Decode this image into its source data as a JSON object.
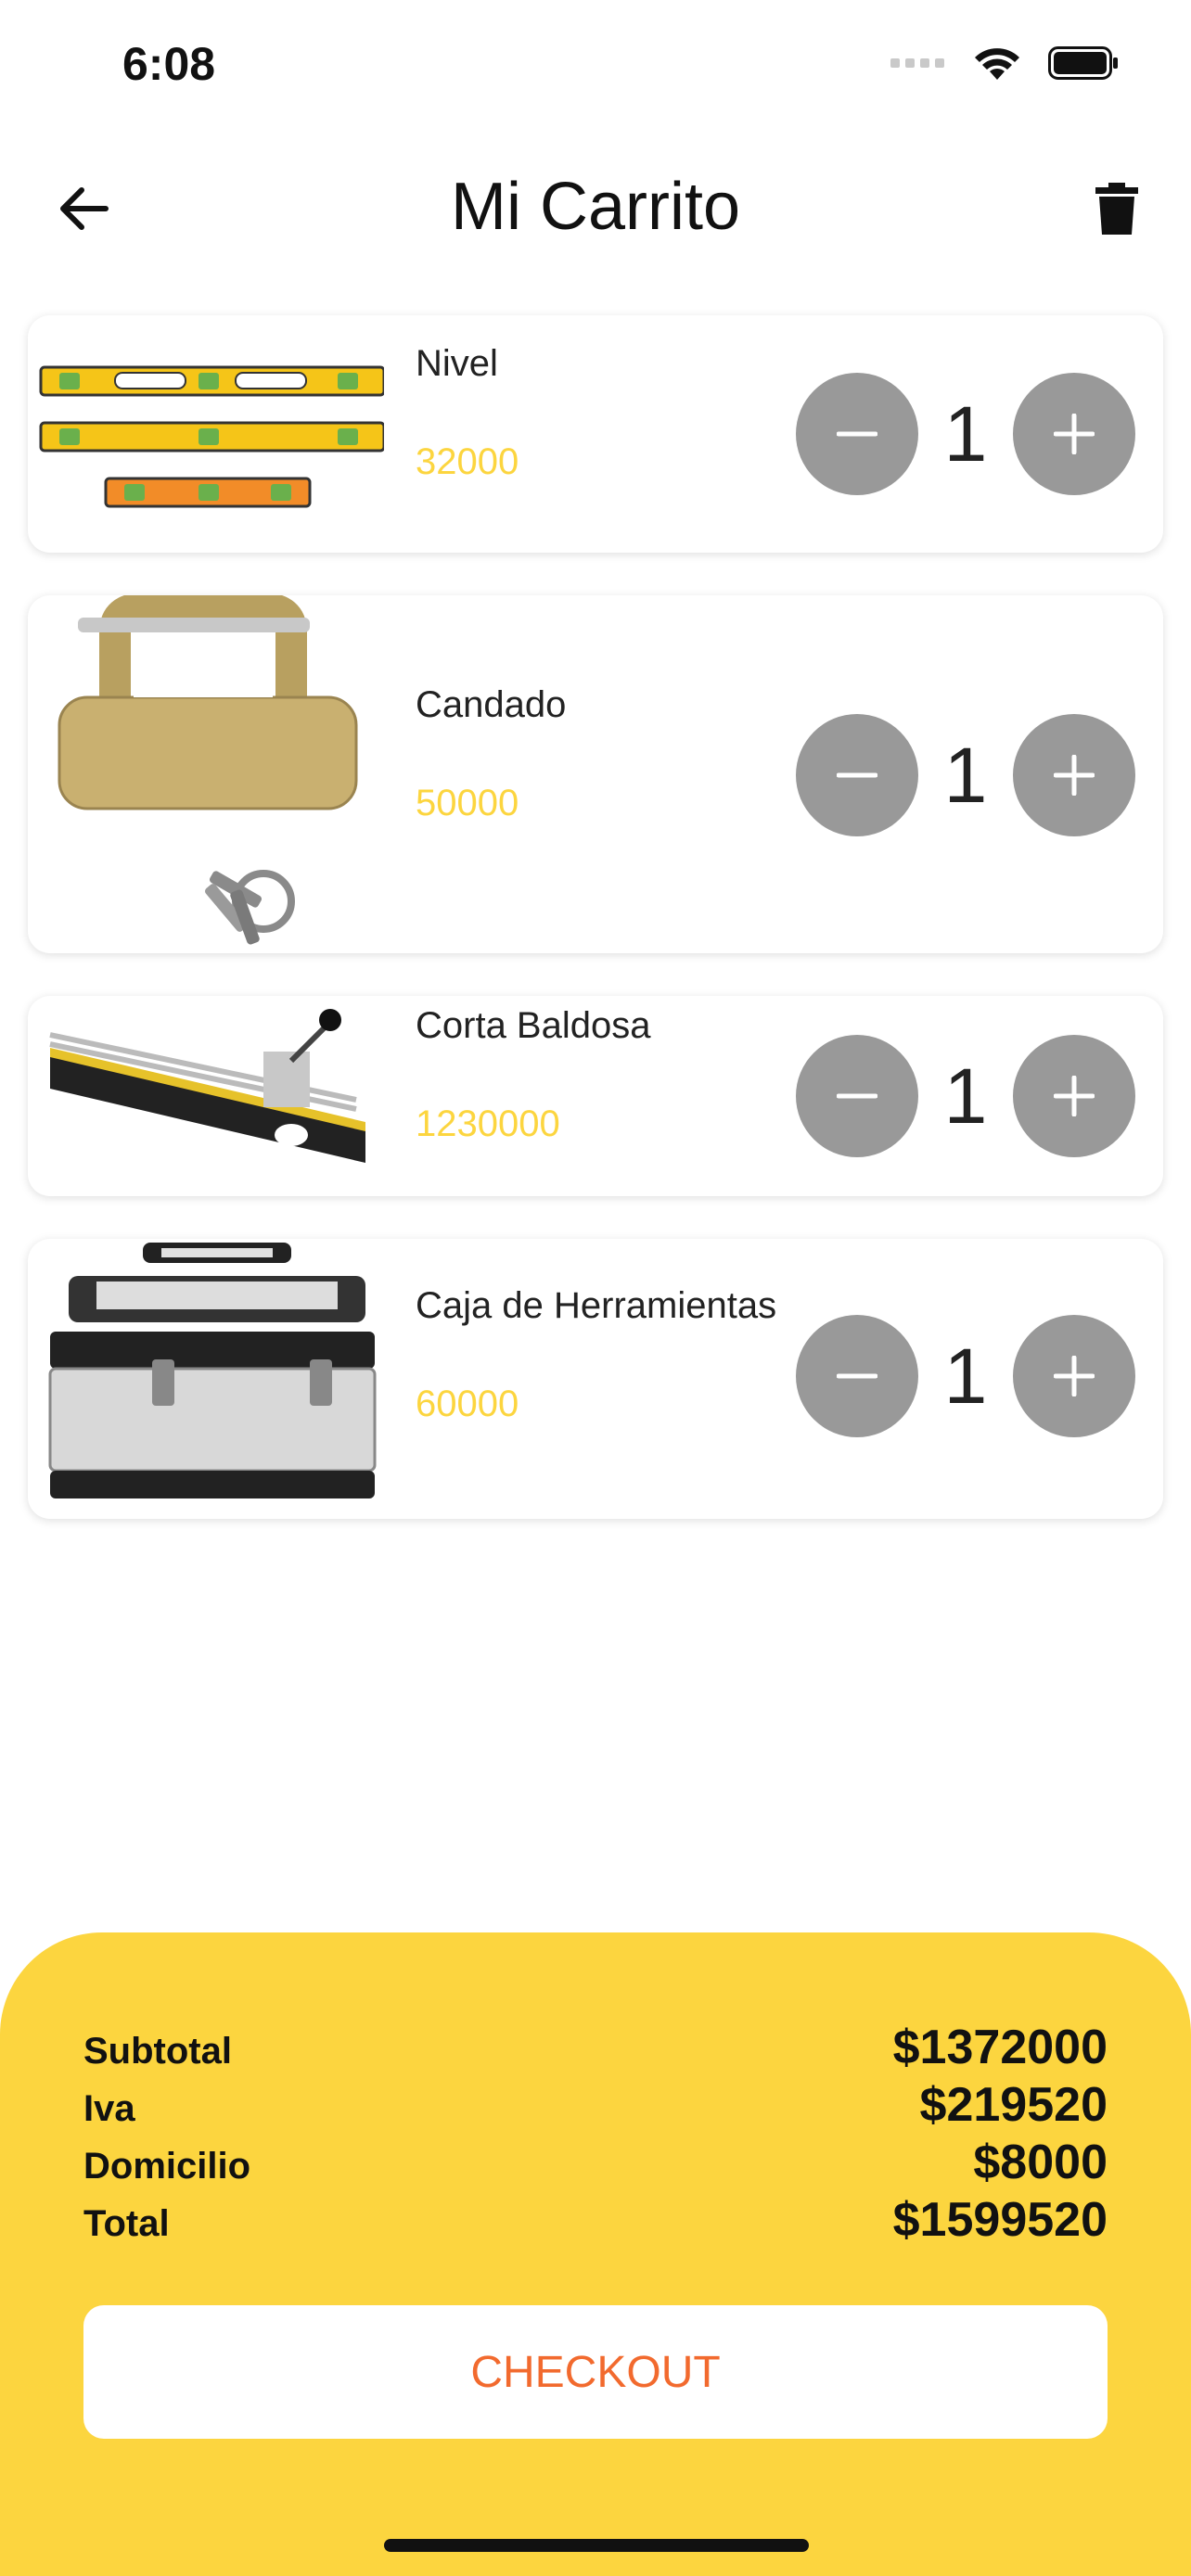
{
  "status": {
    "time": "6:08"
  },
  "header": {
    "title": "Mi Carrito",
    "back_icon": "arrow-left-icon",
    "trash_icon": "trash-icon"
  },
  "cart": {
    "items": [
      {
        "name": "Nivel",
        "price": "32000",
        "quantity": "1"
      },
      {
        "name": "Candado",
        "price": "50000",
        "quantity": "1"
      },
      {
        "name": "Corta Baldosa",
        "price": "1230000",
        "quantity": "1"
      },
      {
        "name": "Caja de Herramientas",
        "price": "60000",
        "quantity": "1"
      }
    ]
  },
  "summary": {
    "subtotal_label": "Subtotal",
    "subtotal_value": "$1372000",
    "iva_label": "Iva",
    "iva_value": "$219520",
    "domicilio_label": "Domicilio",
    "domicilio_value": "$8000",
    "total_label": "Total",
    "total_value": "$1599520",
    "checkout_label": "CHECKOUT"
  },
  "colors": {
    "accent": "#FCD53F",
    "stepper": "#999999",
    "checkout_text": "#F26A2E"
  }
}
